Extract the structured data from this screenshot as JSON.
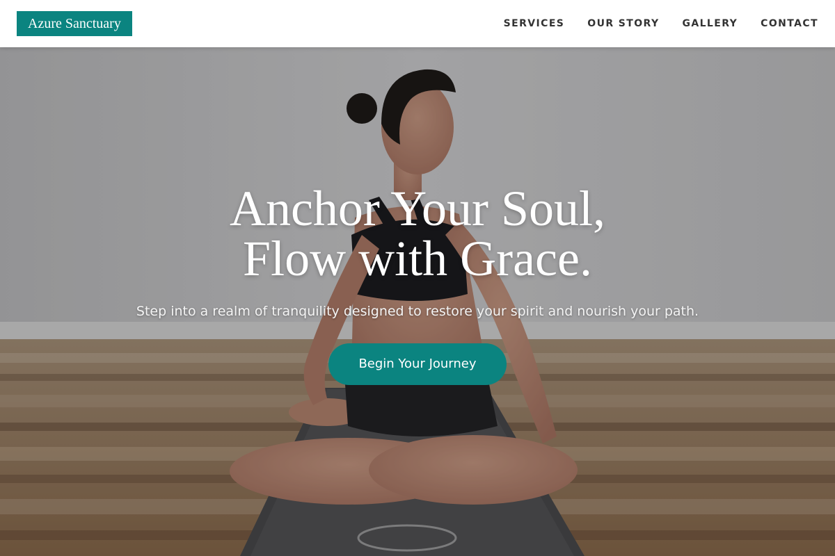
{
  "header": {
    "logo_text": "Azure Sanctuary",
    "nav": [
      {
        "label": "SERVICES"
      },
      {
        "label": "OUR STORY"
      },
      {
        "label": "GALLERY"
      },
      {
        "label": "CONTACT"
      }
    ]
  },
  "hero": {
    "title_line1": "Anchor Your Soul,",
    "title_line2": "Flow with Grace.",
    "subtitle": "Step into a realm of tranquility designed to restore your spirit and nourish your path.",
    "cta_label": "Begin Your Journey",
    "background_icon": "yoga-photo-woman-seated-twist"
  },
  "colors": {
    "accent": "#0b8480",
    "nav_text": "#333333",
    "header_bg": "#ffffff",
    "hero_text": "#ffffff"
  }
}
